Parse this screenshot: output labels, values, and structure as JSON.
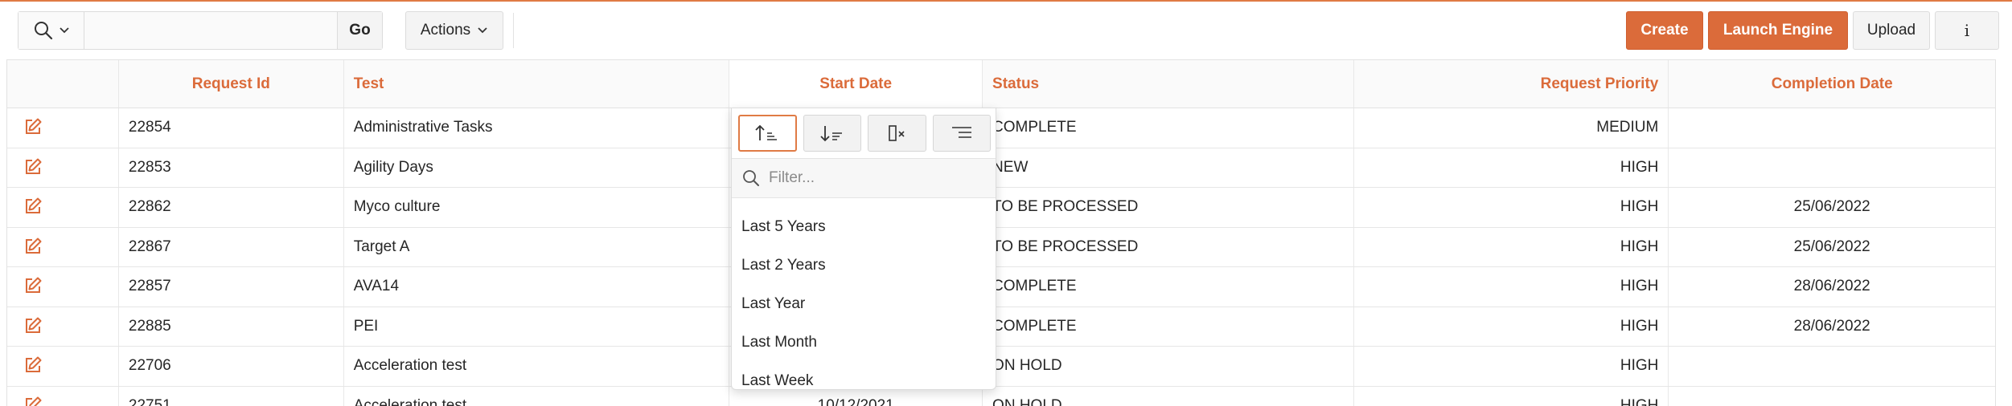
{
  "colors": {
    "accent": "#db6b3a",
    "border": "#e2e2e2"
  },
  "toolbar": {
    "search_icon": "search-icon",
    "search_value": "",
    "go_label": "Go",
    "actions_label": "Actions",
    "create_label": "Create",
    "launch_label": "Launch Engine",
    "upload_label": "Upload",
    "info_label": "i"
  },
  "table": {
    "headers": [
      "Request Id",
      "Test",
      "Start Date",
      "Status",
      "Request Priority",
      "Completion Date"
    ],
    "rows": [
      {
        "id": "22854",
        "test": "Administrative Tasks",
        "start": "",
        "status": "COMPLETE",
        "priority": "MEDIUM",
        "completion": ""
      },
      {
        "id": "22853",
        "test": "Agility Days",
        "start": "",
        "status": "NEW",
        "priority": "HIGH",
        "completion": ""
      },
      {
        "id": "22862",
        "test": "Myco culture",
        "start": "",
        "status": "TO BE PROCESSED",
        "priority": "HIGH",
        "completion": "25/06/2022"
      },
      {
        "id": "22867",
        "test": "Target A",
        "start": "",
        "status": "TO BE PROCESSED",
        "priority": "HIGH",
        "completion": "25/06/2022"
      },
      {
        "id": "22857",
        "test": "AVA14",
        "start": "",
        "status": "COMPLETE",
        "priority": "HIGH",
        "completion": "28/06/2022"
      },
      {
        "id": "22885",
        "test": "PEI",
        "start": "",
        "status": "COMPLETE",
        "priority": "HIGH",
        "completion": "28/06/2022"
      },
      {
        "id": "22706",
        "test": "Acceleration test",
        "start": "",
        "status": "ON HOLD",
        "priority": "HIGH",
        "completion": ""
      },
      {
        "id": "22751",
        "test": "Acceleration test",
        "start": "10/12/2021",
        "status": "ON HOLD",
        "priority": "HIGH",
        "completion": ""
      }
    ]
  },
  "column_menu": {
    "filter_placeholder": "Filter...",
    "options": [
      "Last 5 Years",
      "Last 2 Years",
      "Last Year",
      "Last Month",
      "Last Week"
    ]
  }
}
